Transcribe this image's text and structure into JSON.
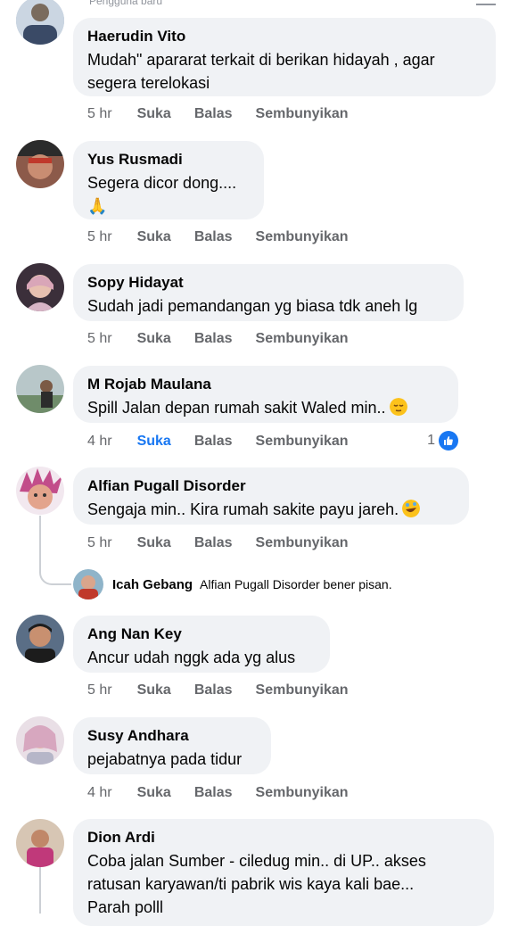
{
  "top_fragment": "Pengguna baru",
  "reply_label": "Balas",
  "comments": [
    {
      "author": "Haerudin Vito",
      "text": "Mudah\" apararat terkait di berikan hidayah , agar",
      "text2": "segera terelokasi",
      "time": "5 hr",
      "like": "Suka",
      "reply": "Balas",
      "hide": "Sembunyikan"
    },
    {
      "author": "Yus Rusmadi",
      "text": "Segera dicor dong....",
      "text2": "🙏",
      "time": "5 hr",
      "like": "Suka",
      "reply": "Balas",
      "hide": "Sembunyikan"
    },
    {
      "author": "Sopy Hidayat",
      "text": "Sudah jadi pemandangan yg biasa tdk aneh lg",
      "time": "5 hr",
      "like": "Suka",
      "reply": "Balas",
      "hide": "Sembunyikan"
    },
    {
      "author": "M Rojab Maulana",
      "text": "Spill Jalan depan rumah sakit Waled min..",
      "time": "4 hr",
      "like": "Suka",
      "reply": "Balas",
      "hide": "Sembunyikan",
      "reaction_count": "1"
    },
    {
      "author": "Alfian Pugall Disorder",
      "text": "Sengaja min.. Kira rumah sakite payu jareh.",
      "time": "5 hr",
      "like": "Suka",
      "reply": "Balas",
      "hide": "Sembunyikan"
    },
    {
      "author": "Ang Nan Key",
      "text": "Ancur udah nggk ada yg alus",
      "time": "5 hr",
      "like": "Suka",
      "reply": "Balas",
      "hide": "Sembunyikan"
    },
    {
      "author": "Susy Andhara",
      "text": "pejabatnya pada tidur",
      "time": "4 hr",
      "like": "Suka",
      "reply": "Balas",
      "hide": "Sembunyikan"
    },
    {
      "author": "Dion Ardi",
      "text": "Coba jalan Sumber - ciledug min.. di UP..    akses",
      "text2": "ratusan karyawan/ti pabrik  wis kaya kali bae...",
      "text3": "Parah polll"
    }
  ],
  "reply_preview": {
    "author": "Icah Gebang",
    "text": "Alfian Pugall Disorder bener pisan."
  },
  "colors": {
    "bubble": "#f0f2f5",
    "meta": "#65676b",
    "accent": "#1877f2"
  }
}
